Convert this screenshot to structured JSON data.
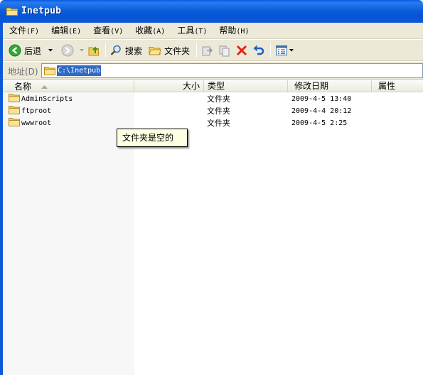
{
  "window": {
    "title": "Inetpub"
  },
  "menu": [
    {
      "label": "文件",
      "mnemonic": "(F)"
    },
    {
      "label": "编辑",
      "mnemonic": "(E)"
    },
    {
      "label": "查看",
      "mnemonic": "(V)"
    },
    {
      "label": "收藏",
      "mnemonic": "(A)"
    },
    {
      "label": "工具",
      "mnemonic": "(T)"
    },
    {
      "label": "帮助",
      "mnemonic": "(H)"
    }
  ],
  "toolbar": {
    "back_label": "后退",
    "search_label": "搜索",
    "folders_label": "文件夹"
  },
  "address": {
    "label": "地址(D)",
    "value": "C:\\Inetpub"
  },
  "columns": {
    "name": "名称",
    "size": "大小",
    "type": "类型",
    "modified": "修改日期",
    "attributes": "属性"
  },
  "files": [
    {
      "name": "AdminScripts",
      "size": "",
      "type": "文件夹",
      "modified": "2009-4-5 13:40"
    },
    {
      "name": "ftproot",
      "size": "",
      "type": "文件夹",
      "modified": "2009-4-4 20:12"
    },
    {
      "name": "wwwroot",
      "size": "",
      "type": "文件夹",
      "modified": "2009-4-5 2:25"
    }
  ],
  "tooltip": "文件夹是空的",
  "icons": {
    "title": "folder-icon",
    "back": "back-arrow-icon",
    "forward": "forward-arrow-icon",
    "up": "folder-up-icon",
    "search": "search-icon",
    "folders": "folders-icon",
    "move_to": "move-to-icon",
    "copy_to": "copy-to-icon",
    "delete": "delete-icon",
    "undo": "undo-icon",
    "views": "views-icon"
  },
  "colors": {
    "titlebar": "#0b5fdb",
    "chrome": "#ece9d8",
    "selection": "#316ac5",
    "tooltip_bg": "#ffffe1"
  }
}
